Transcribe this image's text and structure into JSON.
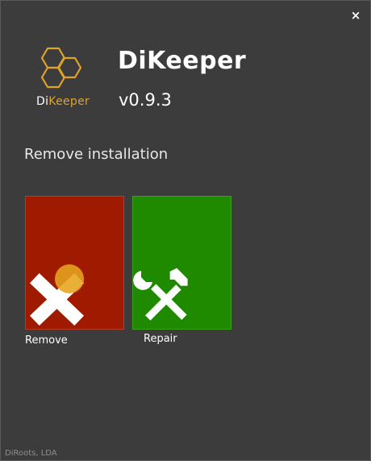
{
  "window": {
    "close_label": "×"
  },
  "header": {
    "logo_text_di": "Di",
    "logo_text_keeper": "Keeper",
    "app_name": "DiKeeper",
    "version": "v0.9.3"
  },
  "main": {
    "section_title": "Remove installation",
    "tiles": [
      {
        "label": "Remove",
        "icon": "close-x-icon",
        "color": "#a01a00"
      },
      {
        "label": "Repair",
        "icon": "tools-icon",
        "color": "#1f8a00"
      }
    ]
  },
  "footer": {
    "company": "DiRoots, LDA"
  },
  "colors": {
    "background": "#3c3c3c",
    "accent": "#e0a32a"
  }
}
